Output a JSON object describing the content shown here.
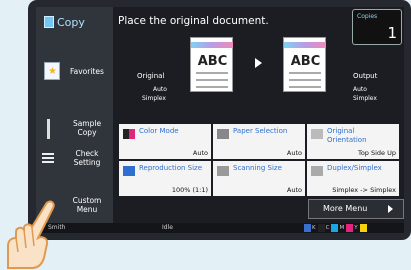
{
  "app": {
    "title": "Copy"
  },
  "sidebar": {
    "favorites": "Favorites",
    "sample_copy": "Sample\nCopy",
    "check_setting": "Check\nSetting",
    "custom_menu": "Custom\nMenu"
  },
  "main": {
    "message": "Place the original document.",
    "copies_label": "Copies",
    "copies_value": "1",
    "original": {
      "title": "Original",
      "line1": "Auto",
      "line2": "Simplex"
    },
    "output": {
      "title": "Output",
      "line1": "Auto",
      "line2": "Simplex"
    },
    "doc_text": "ABC"
  },
  "settings": [
    {
      "title": "Color Mode",
      "value": "Auto",
      "icon": "color-mode-icon"
    },
    {
      "title": "Paper Selection",
      "value": "Auto",
      "icon": "paper-selection-icon"
    },
    {
      "title": "Original\nOrientation",
      "value": "Top Side Up",
      "icon": "orientation-icon"
    },
    {
      "title": "Reproduction Size",
      "value": "100% (1:1)",
      "icon": "reproduction-size-icon"
    },
    {
      "title": "Scanning Size",
      "value": "Auto",
      "icon": "scanning-size-icon"
    },
    {
      "title": "Duplex/Simplex",
      "value": "Simplex -> Simplex",
      "icon": "duplex-icon"
    }
  ],
  "more_menu": "More Menu",
  "status": {
    "user": "Smith",
    "state": "Idle",
    "toner": [
      {
        "label": "K",
        "color": "#222222"
      },
      {
        "label": "C",
        "color": "#1aa6e6"
      },
      {
        "label": "M",
        "color": "#e2257a"
      },
      {
        "label": "Y",
        "color": "#f5d20c"
      }
    ]
  }
}
